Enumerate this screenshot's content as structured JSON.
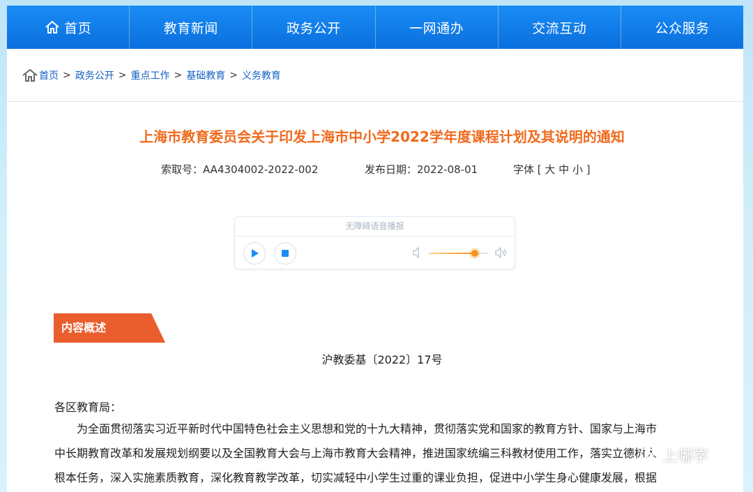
{
  "nav": {
    "items": [
      {
        "label": "首页"
      },
      {
        "label": "教育新闻"
      },
      {
        "label": "政务公开"
      },
      {
        "label": "一网通办"
      },
      {
        "label": "交流互动"
      },
      {
        "label": "公众服务"
      }
    ]
  },
  "breadcrumb": {
    "items": [
      "首页",
      "政务公开",
      "重点工作",
      "基础教育",
      "义务教育"
    ],
    "separator": ">"
  },
  "article": {
    "title": "上海市教育委员会关于印发上海市中小学2022学年度课程计划及其说明的通知",
    "index_no": "索取号：AA4304002-2022-002",
    "publish_date": "发布日期：2022-08-01",
    "font_label": "字体 [",
    "font_large": "大",
    "font_medium": "中",
    "font_small": "小",
    "font_close": "]"
  },
  "player": {
    "label": "无障碍语音播报",
    "volume": 0.78
  },
  "section": {
    "tag": "内容概述"
  },
  "body": {
    "doc_no": "沪教委基〔2022〕17号",
    "salutation": "各区教育局：",
    "lines": [
      "为全面贯彻落实习近平新时代中国特色社会主义思想和党的十九大精神，贯彻落实党和国家的教育方针、国家与上海市",
      "中长期教育改革和发展规划纲要以及全国教育大会与上海市教育大会精神，推进国家统编三科教材使用工作，落实立德树人",
      "根本任务，深入实施素质教育，深化教育教学改革，切实减轻中小学生过重的课业负担，促进中小学生身心健康发展，根据"
    ]
  },
  "watermark": {
    "text": "上哪学"
  },
  "colors": {
    "nav": "#0a6fdd",
    "title": "#f06a1d",
    "section_tag": "#ea5e2d",
    "link": "#1560c4",
    "volume": "#f5941e"
  }
}
